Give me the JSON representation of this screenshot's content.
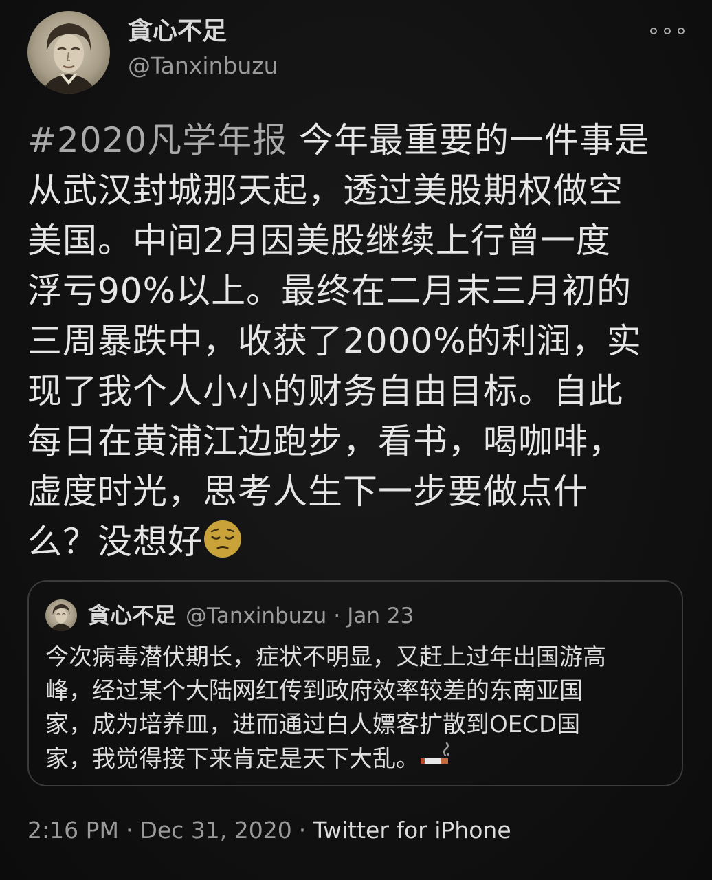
{
  "author": {
    "display_name": "貪心不足",
    "handle": "@Tanxinbuzu",
    "avatar_icon": "portrait-avatar"
  },
  "more_icon": "more-horizontal-icon",
  "tweet": {
    "hashtag": "#2020凡学年报",
    "lines": [
      " 今年最重要的一件事是",
      "从武汉封城那天起，透过美股期权做空",
      "美国。中间2月因美股继续上行曾一度",
      "浮亏90%以上。最终在二月末三月初的",
      "三周暴跌中，收获了2000%的利润，实",
      "现了我个人小小的财务自由目标。自此",
      "每日在黄浦江边跑步，看书，喝咖啡，",
      "虚度时光，思考人生下一步要做点什",
      "么？没想好"
    ],
    "emoji": "pensive-face-emoji"
  },
  "quoted": {
    "display_name": "貪心不足",
    "handle": "@Tanxinbuzu",
    "separator": "·",
    "date": "Jan 23",
    "lines": [
      "今次病毒潜伏期长，症状不明显，又赶上过年出国游高",
      "峰，经过某个大陆网红传到政府效率较差的东南亚国",
      "家，成为培养皿，进而通过白人嫖客扩散到OECD国",
      "家，我觉得接下来肯定是天下大乱。"
    ],
    "emoji": "cigarette-emoji"
  },
  "footer": {
    "time": "2:16 PM",
    "separator": "·",
    "date": "Dec 31, 2020",
    "source": "Twitter for iPhone"
  },
  "colors": {
    "background": "#111111",
    "text": "#e6e6e6",
    "muted": "#9a9a9a",
    "border": "#3a3a3a",
    "emoji_yellow": "#c9a33a"
  }
}
